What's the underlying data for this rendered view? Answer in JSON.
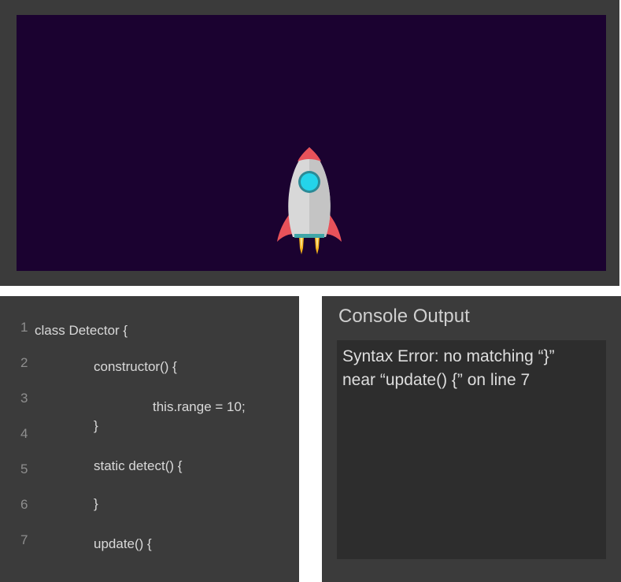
{
  "stage": {
    "sprite_icon": "rocket-icon",
    "background_color": "#1b0230"
  },
  "code_editor": {
    "lines": [
      {
        "number": "1",
        "code": "class Detector {"
      },
      {
        "number": "2",
        "code": "constructor() {"
      },
      {
        "number": "3",
        "code": "this.range = 10;"
      },
      {
        "number": "",
        "code": "}"
      },
      {
        "number": "4",
        "code": ""
      },
      {
        "number": "5",
        "code": "static detect() {"
      },
      {
        "number": "6",
        "code": "}"
      },
      {
        "number": "7",
        "code": "update() {"
      }
    ]
  },
  "console": {
    "title": "Console Output",
    "message_line_1": "Syntax Error: no matching “}”",
    "message_line_2": "near “update() {” on line 7"
  },
  "colors": {
    "panel": "#3b3b3b",
    "console_box": "#2d2d2d",
    "rocket_body": "#d8d8d8",
    "rocket_fins": "#e8525a",
    "rocket_window": "#24d4ea",
    "flame": "#f6b21a"
  }
}
